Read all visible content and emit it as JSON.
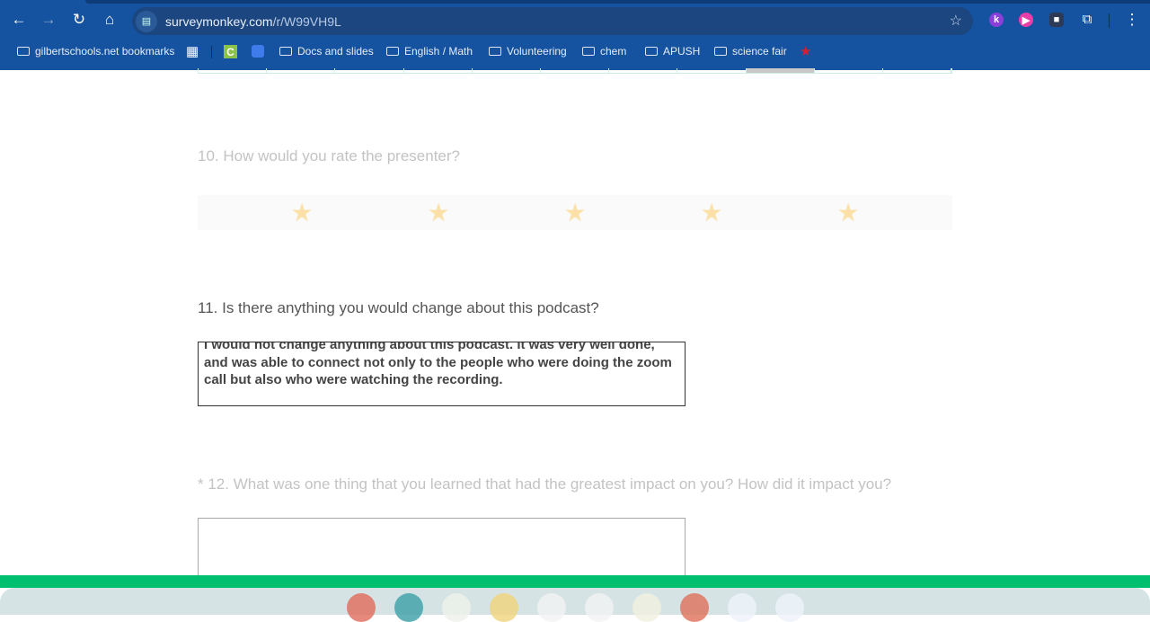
{
  "browser": {
    "url_host": "surveymonkey.com",
    "url_path": "/r/W99VH9L",
    "bookmarks": [
      {
        "label": "gilbertschools.net bookmarks",
        "icon": "managed-folder-icon"
      },
      {
        "label": "Docs and slides",
        "icon": "folder-icon"
      },
      {
        "label": "English / Math",
        "icon": "folder-icon"
      },
      {
        "label": "Volunteering",
        "icon": "folder-icon"
      },
      {
        "label": "chem",
        "icon": "folder-icon"
      },
      {
        "label": "APUSH",
        "icon": "folder-icon"
      },
      {
        "label": "science fair",
        "icon": "folder-icon"
      }
    ],
    "extensions": [
      {
        "label": "k",
        "color": "#8b3fd9"
      },
      {
        "label": "▶",
        "color": "#e83ea8"
      },
      {
        "label": "■",
        "color": "#2d3a55"
      }
    ]
  },
  "survey": {
    "q10": {
      "title": "10. How would you rate the presenter?",
      "rating_max": 5,
      "rating_value": 0
    },
    "q11": {
      "title": "11. Is there anything you would change about this podcast?",
      "answer": "I would not change anything about this podcast. It was very well done, and was able to connect not only to the people who were doing the zoom call but also who were watching the recording."
    },
    "q12": {
      "title": "* 12. What was one thing that you learned that had the greatest impact on you? How did it impact you?",
      "answer": ""
    },
    "brand_color": "#00bf6f"
  },
  "shelf": {
    "apps": [
      {
        "name": "canvas-app",
        "color": "#e06a5a"
      },
      {
        "name": "classroom-screen-app",
        "color": "#3a9fa6"
      },
      {
        "name": "google-classroom-app",
        "color": "#eef1ea"
      },
      {
        "name": "google-keep-app",
        "color": "#f0d37a"
      },
      {
        "name": "google-drive-app",
        "color": "#f2f2f2"
      },
      {
        "name": "gmail-app",
        "color": "#f2f2f2"
      },
      {
        "name": "notes-app",
        "color": "#f0f0e0"
      },
      {
        "name": "chrome-app",
        "color": "#de6f5a"
      },
      {
        "name": "google-docs-app",
        "color": "#eef2fa"
      },
      {
        "name": "play-store-app",
        "color": "#eef2fa"
      }
    ]
  }
}
